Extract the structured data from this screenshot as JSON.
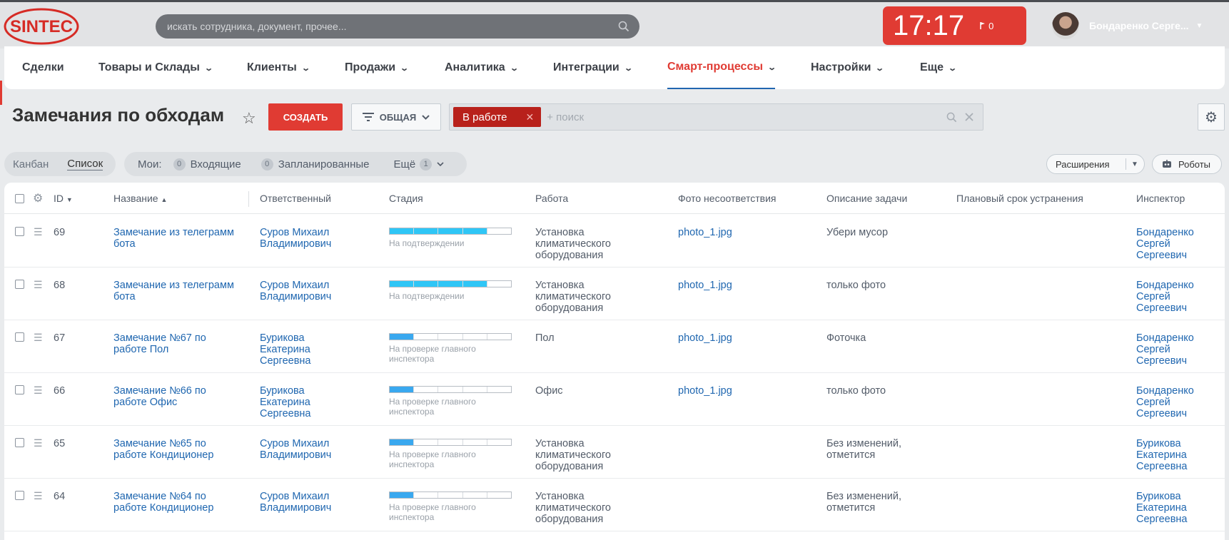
{
  "brand": {
    "logo_text": "SINTEC",
    "accent": "#e03b33",
    "link": "#2067b0"
  },
  "search": {
    "placeholder": "искать сотрудника, документ, прочее..."
  },
  "clock": {
    "time": "17:17",
    "flag_count": "0"
  },
  "user": {
    "name": "Бондаренко Серге..."
  },
  "nav": {
    "items": [
      {
        "label": "Сделки",
        "chevron": false
      },
      {
        "label": "Товары и Склады",
        "chevron": true
      },
      {
        "label": "Клиенты",
        "chevron": true
      },
      {
        "label": "Продажи",
        "chevron": true
      },
      {
        "label": "Аналитика",
        "chevron": true
      },
      {
        "label": "Интеграции",
        "chevron": true
      },
      {
        "label": "Смарт-процессы",
        "chevron": true,
        "active": true
      },
      {
        "label": "Настройки",
        "chevron": true
      },
      {
        "label": "Еще",
        "chevron": true
      }
    ]
  },
  "page": {
    "title": "Замечания по обходам"
  },
  "toolbar": {
    "create_label": "СОЗДАТЬ",
    "filter_label": "ОБЩАЯ",
    "filter_tag": "В работе",
    "filter_placeholder": "+ поиск"
  },
  "views": {
    "kanban": "Канбан",
    "list": "Список"
  },
  "counters": {
    "my_label": "Мои:",
    "incoming_count": "0",
    "incoming_label": "Входящие",
    "planned_count": "0",
    "planned_label": "Запланированные",
    "more_label": "Ещё",
    "more_count": "1"
  },
  "buttons": {
    "extensions": "Расширения",
    "robots": "Роботы"
  },
  "table": {
    "headers": {
      "id": "ID",
      "name": "Название",
      "responsible": "Ответственный",
      "stage": "Стадия",
      "work": "Работа",
      "photo": "Фото несоответствия",
      "description": "Описание задачи",
      "deadline": "Плановый срок устранения",
      "inspector": "Инспектор"
    },
    "rows": [
      {
        "id": "69",
        "name": "Замечание из телеграмм бота",
        "responsible": "Суров Михаил Владимирович",
        "stage": "На подтверждении",
        "stage_progress": 0.8,
        "stage_color": "#2fc6f6",
        "work": "Установка климатического оборудования",
        "photo": "photo_1.jpg",
        "description": "Убери мусор",
        "deadline": "",
        "inspector": "Бондаренко Сергей Сергеевич"
      },
      {
        "id": "68",
        "name": "Замечание из телеграмм бота",
        "responsible": "Суров Михаил Владимирович",
        "stage": "На подтверждении",
        "stage_progress": 0.8,
        "stage_color": "#2fc6f6",
        "work": "Установка климатического оборудования",
        "photo": "photo_1.jpg",
        "description": "только фото",
        "deadline": "",
        "inspector": "Бондаренко Сергей Сергеевич"
      },
      {
        "id": "67",
        "name": "Замечание №67 по работе Пол",
        "responsible": "Бурикова Екатерина Сергеевна",
        "stage": "На проверке главного инспектора",
        "stage_progress": 0.2,
        "stage_color": "#39a8ef",
        "work": "Пол",
        "photo": "photo_1.jpg",
        "description": "Фоточка",
        "deadline": "",
        "inspector": "Бондаренко Сергей Сергеевич"
      },
      {
        "id": "66",
        "name": "Замечание №66 по работе Офис",
        "responsible": "Бурикова Екатерина Сергеевна",
        "stage": "На проверке главного инспектора",
        "stage_progress": 0.2,
        "stage_color": "#39a8ef",
        "work": "Офис",
        "photo": "photo_1.jpg",
        "description": "только фото",
        "deadline": "",
        "inspector": "Бондаренко Сергей Сергеевич"
      },
      {
        "id": "65",
        "name": "Замечание №65 по работе Кондиционер",
        "responsible": "Суров Михаил Владимирович",
        "stage": "На проверке главного инспектора",
        "stage_progress": 0.2,
        "stage_color": "#39a8ef",
        "work": "Установка климатического оборудования",
        "photo": "",
        "description": "Без изменений, отметится",
        "deadline": "",
        "inspector": "Бурикова Екатерина Сергеевна"
      },
      {
        "id": "64",
        "name": "Замечание №64 по работе Кондиционер",
        "responsible": "Суров Михаил Владимирович",
        "stage": "На проверке главного инспектора",
        "stage_progress": 0.2,
        "stage_color": "#39a8ef",
        "work": "Установка климатического оборудования",
        "photo": "",
        "description": "Без изменений, отметится",
        "deadline": "",
        "inspector": "Бурикова Екатерина Сергеевна"
      }
    ]
  }
}
